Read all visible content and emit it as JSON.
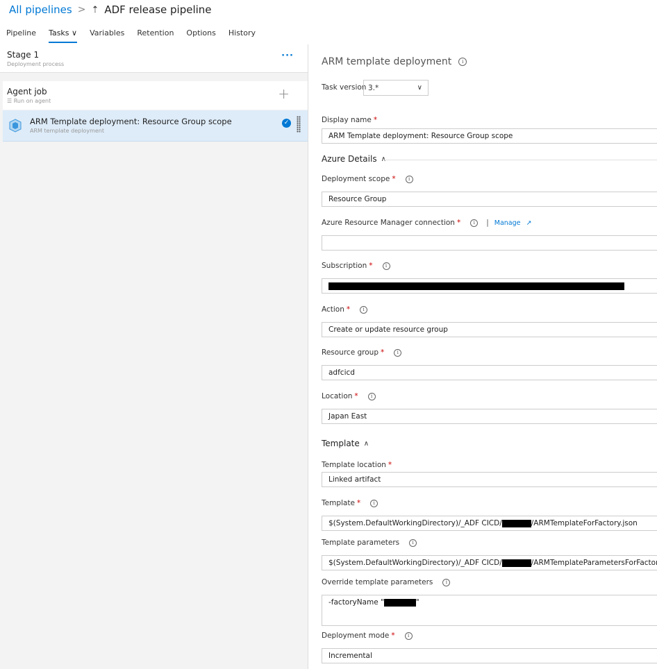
{
  "breadcrumb": {
    "all_pipelines": "All pipelines",
    "separator": ">",
    "pipeline_title": "ADF release pipeline"
  },
  "tabs": [
    {
      "label": "Pipeline"
    },
    {
      "label": "Tasks ∨"
    },
    {
      "label": "Variables"
    },
    {
      "label": "Retention"
    },
    {
      "label": "Options"
    },
    {
      "label": "History"
    }
  ],
  "stage": {
    "name": "Stage 1",
    "sub": "Deployment process",
    "more": "···"
  },
  "agent_job": {
    "name": "Agent job",
    "sub": "Run on agent",
    "add": "+"
  },
  "task": {
    "name": "ARM Template deployment: Resource Group scope",
    "sub": "ARM template deployment"
  },
  "panel": {
    "title": "ARM template deployment",
    "task_version_label": "Task version",
    "task_version_value": "3.*",
    "display_name_label": "Display name",
    "display_name_value": "ARM Template deployment: Resource Group scope",
    "azure_details": "Azure Details",
    "deployment_scope_label": "Deployment scope",
    "deployment_scope_value": "Resource Group",
    "arm_connection_label": "Azure Resource Manager connection",
    "manage": "Manage",
    "subscription_label": "Subscription",
    "action_label": "Action",
    "action_value": "Create or update resource group",
    "resource_group_label": "Resource group",
    "resource_group_value": "adfcicd",
    "location_label": "Location",
    "location_value": "Japan East",
    "template_section": "Template",
    "template_location_label": "Template location",
    "template_location_value": "Linked artifact",
    "template_label": "Template",
    "template_prefix": "$(System.DefaultWorkingDirectory)/_ADF CICD/",
    "template_suffix": "/ARMTemplateForFactory.json",
    "template_params_label": "Template parameters",
    "template_params_suffix": "/ARMTemplateParametersForFactory.json",
    "override_label": "Override template parameters",
    "override_prefix": "-factoryName \"",
    "override_suffix": "\"",
    "deployment_mode_label": "Deployment mode",
    "deployment_mode_value": "Incremental",
    "required_mark": "*"
  }
}
